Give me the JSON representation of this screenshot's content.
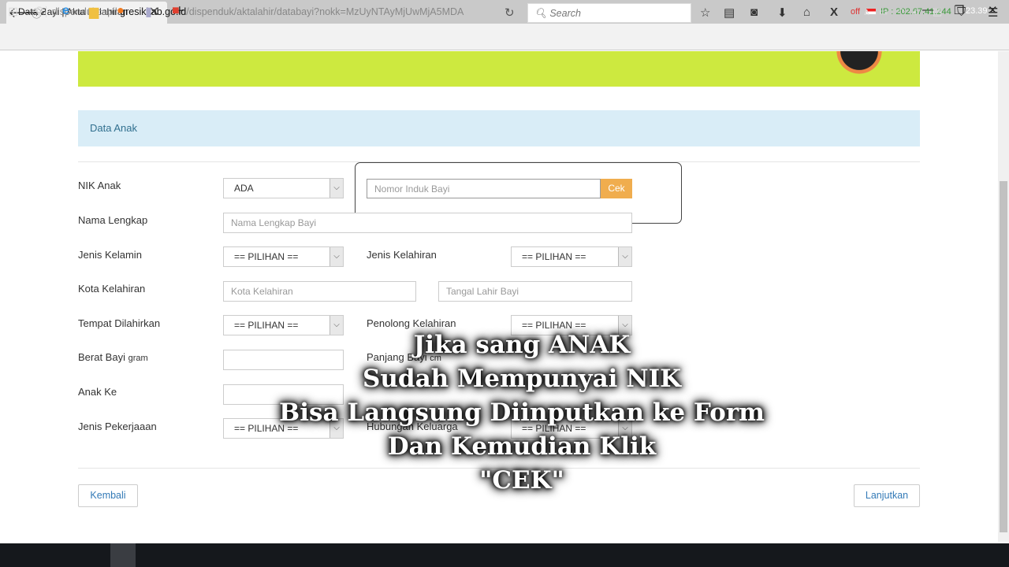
{
  "browser": {
    "tab_title": "Data Bayi | Akta Kelahiran",
    "url_prefix": "dispendukcapil.",
    "url_domain": "gresikkab.go.id",
    "url_path": "/dispenduk/aktalahir/databayi?nokk=MzUyNTAyMjUwMjA5MDA",
    "search_placeholder": "Search",
    "proxy_status": "off",
    "ip_label": "IP : 202.67.41.244"
  },
  "panel": {
    "title": "Data Anak"
  },
  "form": {
    "nik_label": "NIK Anak",
    "nik_select": "ADA",
    "nik_placeholder": "Nomor Induk Bayi",
    "cek_label": "Cek",
    "nama_label": "Nama Lengkap",
    "nama_placeholder": "Nama Lengkap Bayi",
    "jk_label": "Jenis Kelamin",
    "jk_value": "== PILIHAN ==",
    "jkel_label": "Jenis Kelahiran",
    "jkel_value": "== PILIHAN ==",
    "kota_label": "Kota Kelahiran",
    "kota_placeholder": "Kota Kelahiran",
    "tgl_placeholder": "Tangal Lahir Bayi",
    "tempat_label": "Tempat Dilahirkan",
    "tempat_value": "== PILIHAN ==",
    "penolong_label": "Penolong Kelahiran",
    "penolong_value": "== PILIHAN ==",
    "berat_label": "Berat Bayi",
    "berat_unit": "gram",
    "panjang_label": "Panjang Bayi",
    "panjang_unit": "cm",
    "anakke_label": "Anak Ke",
    "pekerjaan_label": "Jenis Pekerjaaan",
    "pekerjaan_value": "== PILIHAN ==",
    "hubungan_label": "Hubungan Keluarga",
    "hubungan_value": "== PILIHAN ==",
    "back_label": "Kembali",
    "next_label": "Lanjutkan"
  },
  "caption": {
    "lines": [
      "Jika sang ANAK",
      "Sudah Mempunyai NIK",
      "Bisa Langsung Diinputkan ke Form",
      "Dan Kemudian Klik",
      "\"CEK\""
    ]
  },
  "taskbar": {
    "clock": "23.39"
  },
  "colors": {
    "banner": "#cde93f",
    "panel": "#d9edf7",
    "cek": "#f0ad4e"
  }
}
